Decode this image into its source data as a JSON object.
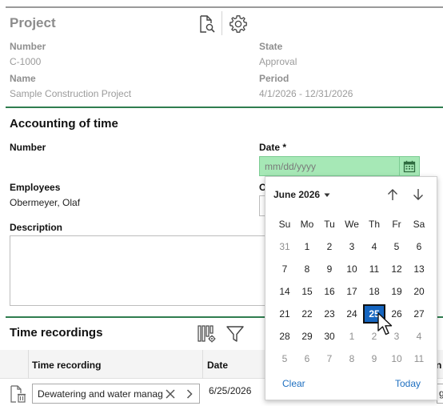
{
  "project": {
    "title": "Project",
    "number_label": "Number",
    "number_value": "C-1000",
    "state_label": "State",
    "state_value": "Approval",
    "name_label": "Name",
    "name_value": "Sample Construction Project",
    "period_label": "Period",
    "period_value": "4/1/2026 - 12/31/2026"
  },
  "accounting": {
    "title": "Accounting of time",
    "number_label": "Number",
    "date_label": "Date *",
    "date_placeholder": "mm/dd/yyyy",
    "employees_label": "Employees",
    "employees_value": "Obermeyer, Olaf",
    "partial_label": "C",
    "description_label": "Description"
  },
  "time_recordings": {
    "title": "Time recordings",
    "col_recording": "Time recording",
    "col_date": "Date",
    "col_partial": "n",
    "row_recording": "Dewatering and water management",
    "row_date": "6/25/2026",
    "row_partial": "g"
  },
  "picker": {
    "month_label": "June 2026",
    "weekdays": [
      "Su",
      "Mo",
      "Tu",
      "We",
      "Th",
      "Fr",
      "Sa"
    ],
    "weeks": [
      [
        "31",
        "1",
        "2",
        "3",
        "4",
        "5",
        "6"
      ],
      [
        "7",
        "8",
        "9",
        "10",
        "11",
        "12",
        "13"
      ],
      [
        "14",
        "15",
        "16",
        "17",
        "18",
        "19",
        "20"
      ],
      [
        "21",
        "22",
        "23",
        "24",
        "25",
        "26",
        "27"
      ],
      [
        "28",
        "29",
        "30",
        "1",
        "2",
        "3",
        "4"
      ],
      [
        "5",
        "6",
        "7",
        "8",
        "9",
        "10",
        "11"
      ]
    ],
    "selected_day": "25",
    "clear_label": "Clear",
    "today_label": "Today"
  },
  "colors": {
    "accent_green": "#2f7d4f",
    "date_field_bg": "#a6e8b6",
    "selected_day_bg": "#1565c0",
    "link_blue": "#1e6fc0"
  },
  "icons": [
    "document-search-icon",
    "gear-icon",
    "calendar-icon",
    "chevron-down-icon",
    "arrow-up-icon",
    "arrow-down-icon",
    "columns-settings-icon",
    "filter-icon",
    "clear-x-icon",
    "chevron-right-icon",
    "document-delete-icon",
    "mouse-cursor-icon"
  ]
}
